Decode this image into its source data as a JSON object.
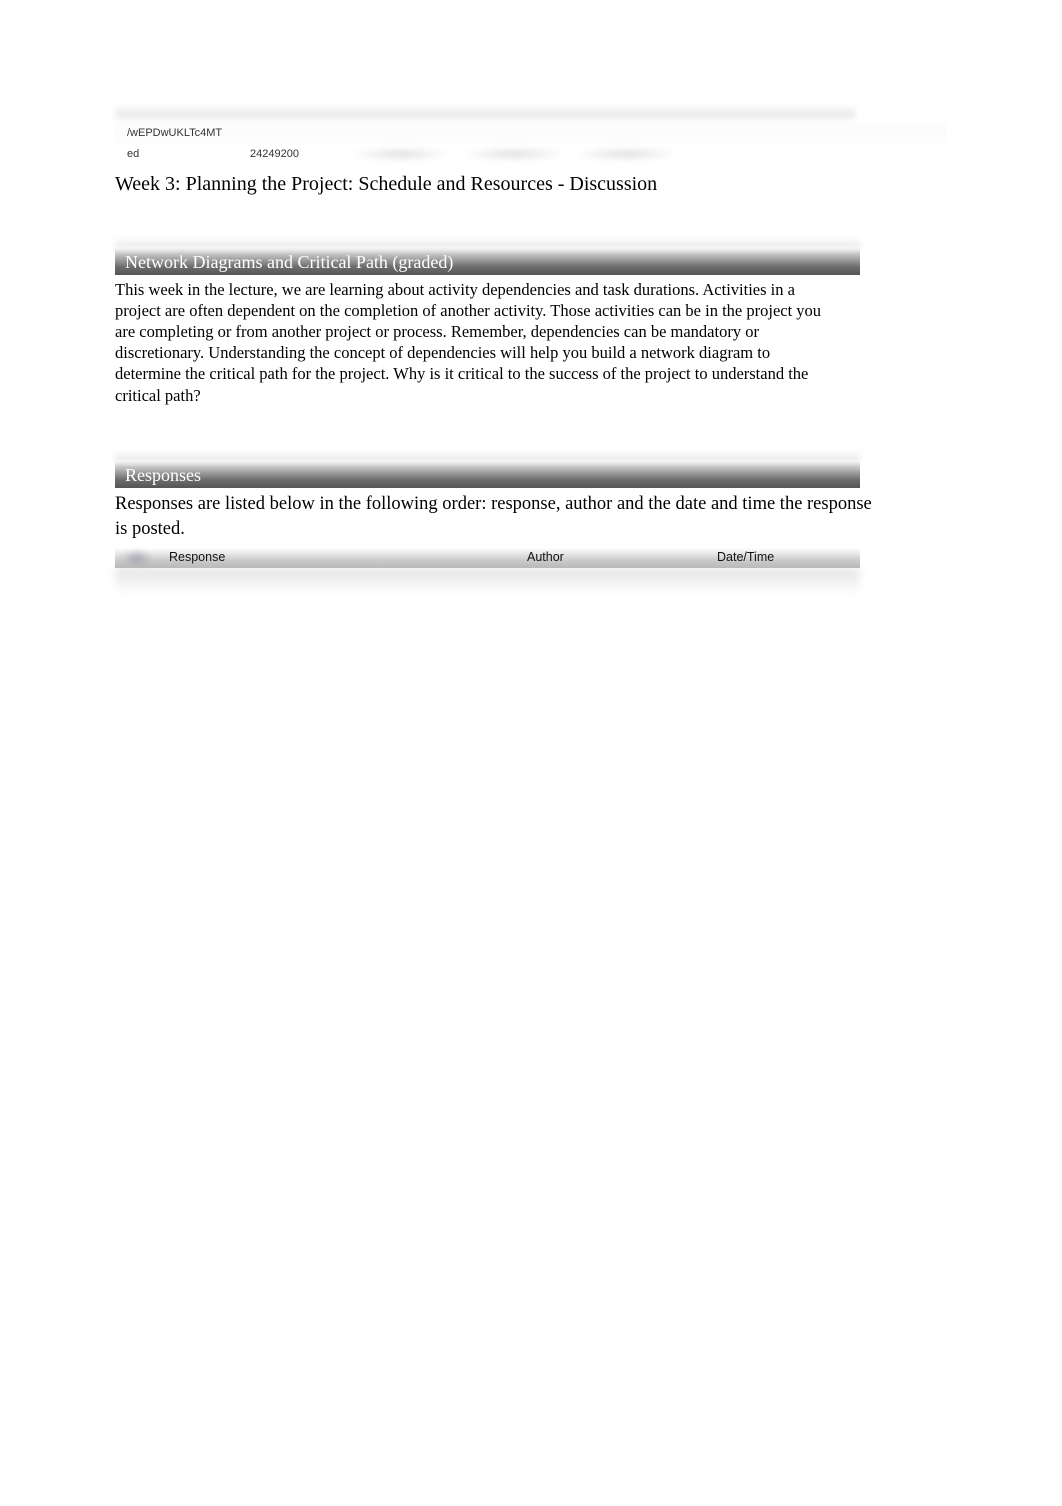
{
  "meta": {
    "code_fragment_1": "/wEPDwUKLTc4MT",
    "code_value_a": "ed",
    "code_value_b": "24249200"
  },
  "page": {
    "title": "Week 3: Planning the Project: Schedule and Resources - Discussion"
  },
  "discussion": {
    "title": "Network Diagrams and Critical Path (graded)",
    "prompt": "This week in the lecture, we are learning about activity dependencies and task durations. Activities in a project are often dependent on the completion of another activity. Those activities can be in the project you are completing or from another project or process. Remember, dependencies can be mandatory or discretionary. Understanding the concept of dependencies will help you build a network diagram to determine the critical path for the project. Why is it critical to the success of the project to understand the critical path?"
  },
  "responses": {
    "header": "Responses",
    "description": "Responses are listed below in the following order: response, author and the date and time the response is posted.",
    "columns": {
      "response": "Response",
      "author": "Author",
      "datetime": "Date/Time"
    }
  }
}
